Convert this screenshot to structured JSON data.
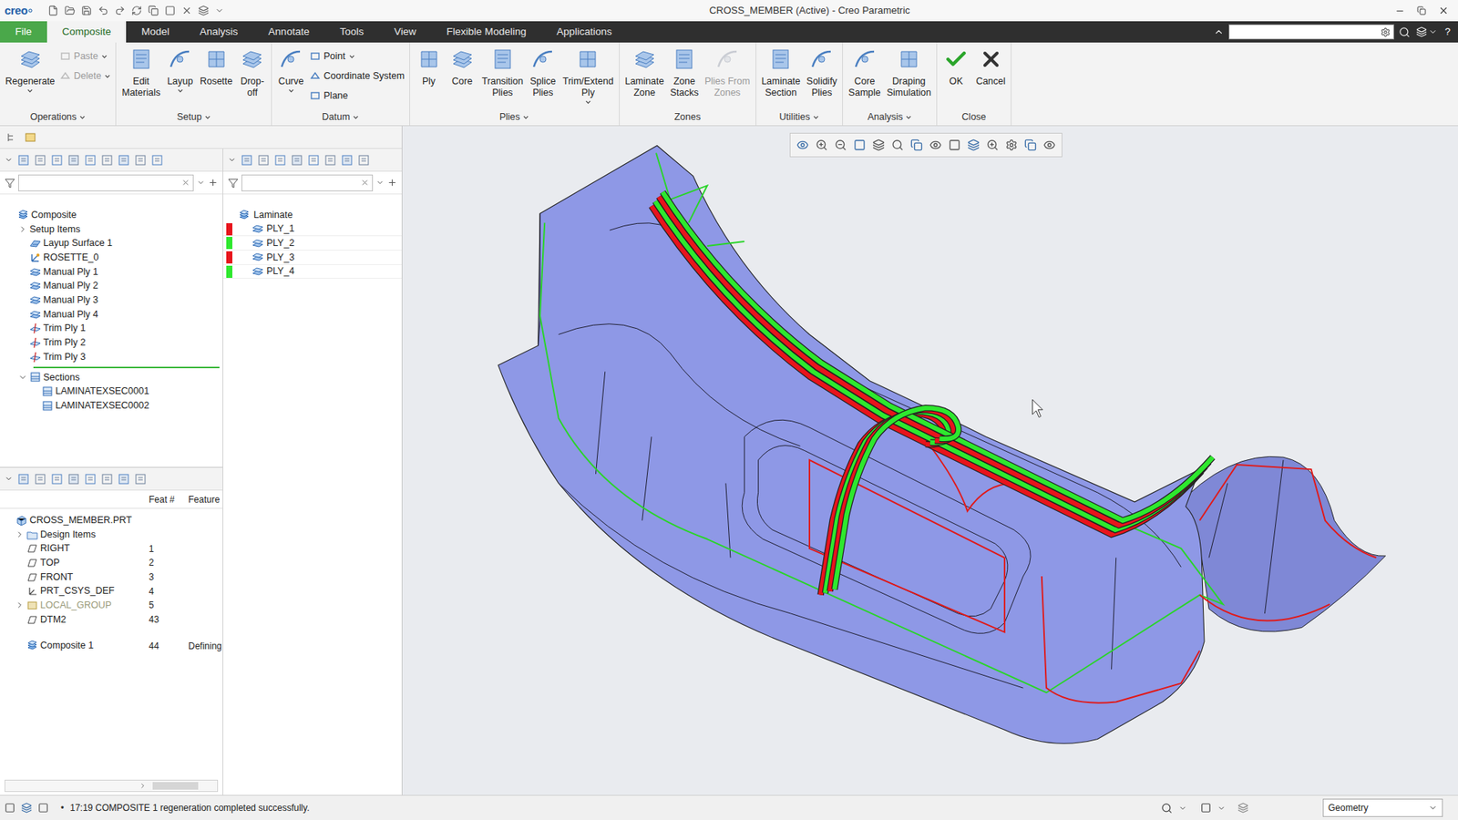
{
  "window": {
    "logo": "creo",
    "title": "CROSS_MEMBER (Active) - Creo Parametric",
    "help": "?"
  },
  "menu_tabs": [
    {
      "label": "File",
      "selected": false,
      "kind": "file"
    },
    {
      "label": "Composite",
      "selected": true,
      "kind": "tab"
    },
    {
      "label": "Model",
      "selected": false,
      "kind": "tab"
    },
    {
      "label": "Analysis",
      "selected": false,
      "kind": "tab"
    },
    {
      "label": "Annotate",
      "selected": false,
      "kind": "tab"
    },
    {
      "label": "Tools",
      "selected": false,
      "kind": "tab"
    },
    {
      "label": "View",
      "selected": false,
      "kind": "tab"
    },
    {
      "label": "Flexible Modeling",
      "selected": false,
      "kind": "tab"
    },
    {
      "label": "Applications",
      "selected": false,
      "kind": "tab"
    }
  ],
  "search": {
    "placeholder": ""
  },
  "ribbon": [
    {
      "label": "Operations",
      "menu": true,
      "items": [
        {
          "lines": [
            "Regenerate"
          ],
          "kind": "large",
          "menu": true,
          "disabled": false
        },
        {
          "lines": [
            "Paste"
          ],
          "kind": "small",
          "menu": true,
          "disabled": true
        },
        {
          "lines": [
            "Delete"
          ],
          "kind": "small",
          "menu": true,
          "disabled": true
        }
      ]
    },
    {
      "label": "Setup",
      "menu": true,
      "items": [
        {
          "lines": [
            "Edit",
            "Materials"
          ],
          "kind": "large",
          "menu": false,
          "disabled": false
        },
        {
          "lines": [
            "Layup"
          ],
          "kind": "large",
          "menu": true,
          "disabled": false
        },
        {
          "lines": [
            "Rosette"
          ],
          "kind": "large",
          "menu": false,
          "disabled": false
        },
        {
          "lines": [
            "Drop-",
            "off"
          ],
          "kind": "large",
          "menu": false,
          "disabled": false
        }
      ]
    },
    {
      "label": "Datum",
      "menu": true,
      "items": [
        {
          "lines": [
            "Curve"
          ],
          "kind": "large",
          "menu": true,
          "disabled": false
        },
        {
          "lines": [
            "Point"
          ],
          "kind": "small",
          "menu": true,
          "disabled": false
        },
        {
          "lines": [
            "Coordinate System"
          ],
          "kind": "small",
          "menu": false,
          "disabled": false
        },
        {
          "lines": [
            "Plane"
          ],
          "kind": "small",
          "menu": false,
          "disabled": false
        }
      ]
    },
    {
      "label": "Plies",
      "menu": true,
      "items": [
        {
          "lines": [
            "Ply"
          ],
          "kind": "large",
          "menu": false,
          "disabled": false
        },
        {
          "lines": [
            "Core"
          ],
          "kind": "large",
          "menu": false,
          "disabled": false
        },
        {
          "lines": [
            "Transition",
            "Plies"
          ],
          "kind": "large",
          "menu": false,
          "disabled": false
        },
        {
          "lines": [
            "Splice",
            "Plies"
          ],
          "kind": "large",
          "menu": false,
          "disabled": false
        },
        {
          "lines": [
            "Trim/Extend",
            "Ply"
          ],
          "kind": "large",
          "menu": true,
          "disabled": false
        }
      ]
    },
    {
      "label": "Zones",
      "menu": false,
      "items": [
        {
          "lines": [
            "Laminate",
            "Zone"
          ],
          "kind": "large",
          "menu": false,
          "disabled": false
        },
        {
          "lines": [
            "Zone",
            "Stacks"
          ],
          "kind": "large",
          "menu": false,
          "disabled": false
        },
        {
          "lines": [
            "Plies From",
            "Zones"
          ],
          "kind": "large",
          "menu": false,
          "disabled": true
        }
      ]
    },
    {
      "label": "Utilities",
      "menu": true,
      "items": [
        {
          "lines": [
            "Laminate",
            "Section"
          ],
          "kind": "large",
          "menu": false,
          "disabled": false
        },
        {
          "lines": [
            "Solidify",
            "Plies"
          ],
          "kind": "large",
          "menu": false,
          "disabled": false
        }
      ]
    },
    {
      "label": "Analysis",
      "menu": true,
      "items": [
        {
          "lines": [
            "Core",
            "Sample"
          ],
          "kind": "large",
          "menu": false,
          "disabled": false
        },
        {
          "lines": [
            "Draping",
            "Simulation"
          ],
          "kind": "large",
          "menu": false,
          "disabled": false
        }
      ]
    },
    {
      "label": "Close",
      "menu": false,
      "items": [
        {
          "lines": [
            "OK"
          ],
          "kind": "ok",
          "menu": false,
          "disabled": false
        },
        {
          "lines": [
            "Cancel"
          ],
          "kind": "cancel",
          "menu": false,
          "disabled": false
        }
      ]
    }
  ],
  "tree_filter": {
    "placeholder": ""
  },
  "model_tree": [
    {
      "label": "Composite",
      "kind": "composite",
      "level": 0,
      "expandable": false,
      "expanded": false,
      "insert_after": false
    },
    {
      "label": "Setup Items",
      "kind": "none",
      "level": 1,
      "expandable": true,
      "expanded": false,
      "insert_after": false
    },
    {
      "label": "Layup Surface 1",
      "kind": "surface",
      "level": 1,
      "expandable": false,
      "expanded": false,
      "insert_after": false
    },
    {
      "label": "ROSETTE_0",
      "kind": "rosette",
      "level": 1,
      "expandable": false,
      "expanded": false,
      "insert_after": false
    },
    {
      "label": "Manual Ply 1",
      "kind": "ply",
      "level": 1,
      "expandable": false,
      "expanded": false,
      "insert_after": false
    },
    {
      "label": "Manual Ply 2",
      "kind": "ply",
      "level": 1,
      "expandable": false,
      "expanded": false,
      "insert_after": false
    },
    {
      "label": "Manual Ply 3",
      "kind": "ply",
      "level": 1,
      "expandable": false,
      "expanded": false,
      "insert_after": false
    },
    {
      "label": "Manual Ply 4",
      "kind": "ply",
      "level": 1,
      "expandable": false,
      "expanded": false,
      "insert_after": false
    },
    {
      "label": "Trim Ply 1",
      "kind": "trim",
      "level": 1,
      "expandable": false,
      "expanded": false,
      "insert_after": false
    },
    {
      "label": "Trim Ply 2",
      "kind": "trim",
      "level": 1,
      "expandable": false,
      "expanded": false,
      "insert_after": false
    },
    {
      "label": "Trim Ply 3",
      "kind": "trim",
      "level": 1,
      "expandable": false,
      "expanded": false,
      "insert_after": true
    },
    {
      "label": "Sections",
      "kind": "sections",
      "level": 1,
      "expandable": true,
      "expanded": true,
      "insert_after": false
    },
    {
      "label": "LAMINATEXSEC0001",
      "kind": "section",
      "level": 2,
      "expandable": false,
      "expanded": false,
      "insert_after": false
    },
    {
      "label": "LAMINATEXSEC0002",
      "kind": "section",
      "level": 2,
      "expandable": false,
      "expanded": false,
      "insert_after": false
    }
  ],
  "laminate_filter": {
    "placeholder": ""
  },
  "laminate": {
    "label": "Laminate",
    "plies": [
      {
        "label": "PLY_1",
        "color": "#e8141c"
      },
      {
        "label": "PLY_2",
        "color": "#2ee82e"
      },
      {
        "label": "PLY_3",
        "color": "#e8141c"
      },
      {
        "label": "PLY_4",
        "color": "#2ee82e"
      }
    ]
  },
  "feature_tree": {
    "columns": [
      "Feat #",
      "Feature"
    ],
    "rows": [
      {
        "label": "CROSS_MEMBER.PRT",
        "kind": "part",
        "level": 0,
        "feat": "",
        "feature": "",
        "expandable": false,
        "disabled": false
      },
      {
        "label": "Design Items",
        "kind": "folder",
        "level": 1,
        "feat": "",
        "feature": "",
        "expandable": true,
        "disabled": false
      },
      {
        "label": "RIGHT",
        "kind": "plane",
        "level": 1,
        "feat": "1",
        "feature": "",
        "expandable": false,
        "disabled": false
      },
      {
        "label": "TOP",
        "kind": "plane",
        "level": 1,
        "feat": "2",
        "feature": "",
        "expandable": false,
        "disabled": false
      },
      {
        "label": "FRONT",
        "kind": "plane",
        "level": 1,
        "feat": "3",
        "feature": "",
        "expandable": false,
        "disabled": false
      },
      {
        "label": "PRT_CSYS_DEF",
        "kind": "csys",
        "level": 1,
        "feat": "4",
        "feature": "",
        "expandable": false,
        "disabled": false
      },
      {
        "label": "LOCAL_GROUP",
        "kind": "group",
        "level": 1,
        "feat": "5",
        "feature": "",
        "expandable": true,
        "disabled": true
      },
      {
        "label": "DTM2",
        "kind": "plane",
        "level": 1,
        "feat": "43",
        "feature": "",
        "expandable": false,
        "disabled": false
      },
      {
        "label": "Composite 1",
        "kind": "composite",
        "level": 1,
        "feat": "44",
        "feature": "Defining",
        "expandable": false,
        "disabled": false
      }
    ]
  },
  "status_bar": {
    "bullet": "•",
    "message": "17:19 COMPOSITE 1 regeneration completed successfully.",
    "filter": "Geometry"
  }
}
